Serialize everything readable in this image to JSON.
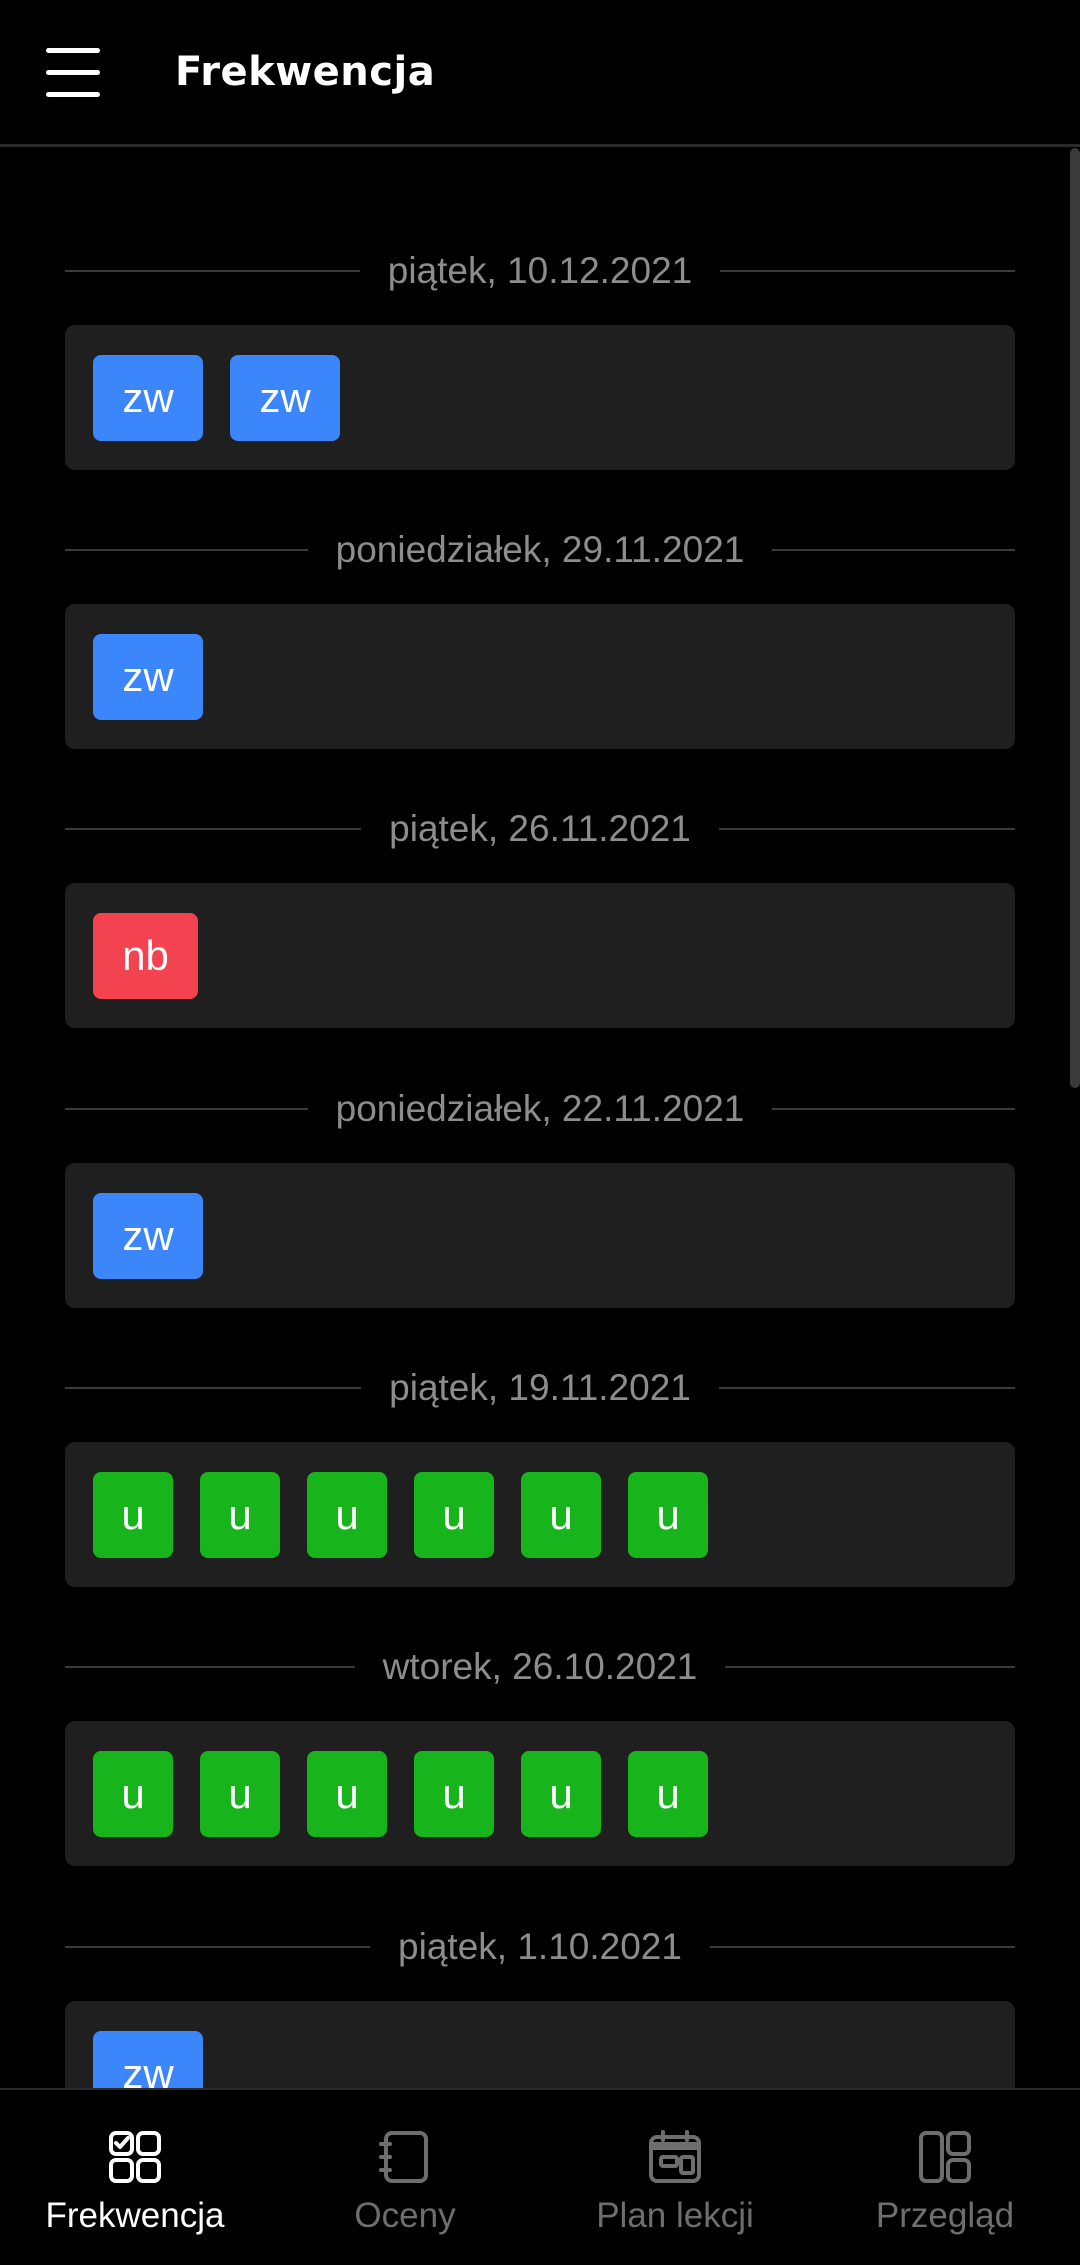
{
  "header": {
    "title": "Frekwencja",
    "menu_icon": "menu-icon"
  },
  "colors": {
    "zw": "#3c86fb",
    "nb": "#f44350",
    "u": "#18b41c",
    "card_bg": "#1f1f1f"
  },
  "days": [
    {
      "date": "piątek, 10.12.2021",
      "entries": [
        "zw",
        "zw"
      ]
    },
    {
      "date": "poniedziałek, 29.11.2021",
      "entries": [
        "zw"
      ]
    },
    {
      "date": "piątek, 26.11.2021",
      "entries": [
        "nb"
      ]
    },
    {
      "date": "poniedziałek, 22.11.2021",
      "entries": [
        "zw"
      ]
    },
    {
      "date": "piątek, 19.11.2021",
      "entries": [
        "u",
        "u",
        "u",
        "u",
        "u",
        "u"
      ]
    },
    {
      "date": "wtorek, 26.10.2021",
      "entries": [
        "u",
        "u",
        "u",
        "u",
        "u",
        "u"
      ]
    },
    {
      "date": "piątek, 1.10.2021",
      "entries": [
        "zw"
      ]
    }
  ],
  "bottom_nav": {
    "items": [
      {
        "label": "Frekwencja",
        "icon": "attendance-grid-icon",
        "active": true
      },
      {
        "label": "Oceny",
        "icon": "notebook-icon",
        "active": false
      },
      {
        "label": "Plan lekcji",
        "icon": "calendar-icon",
        "active": false
      },
      {
        "label": "Przegląd",
        "icon": "dashboard-icon",
        "active": false
      }
    ]
  }
}
